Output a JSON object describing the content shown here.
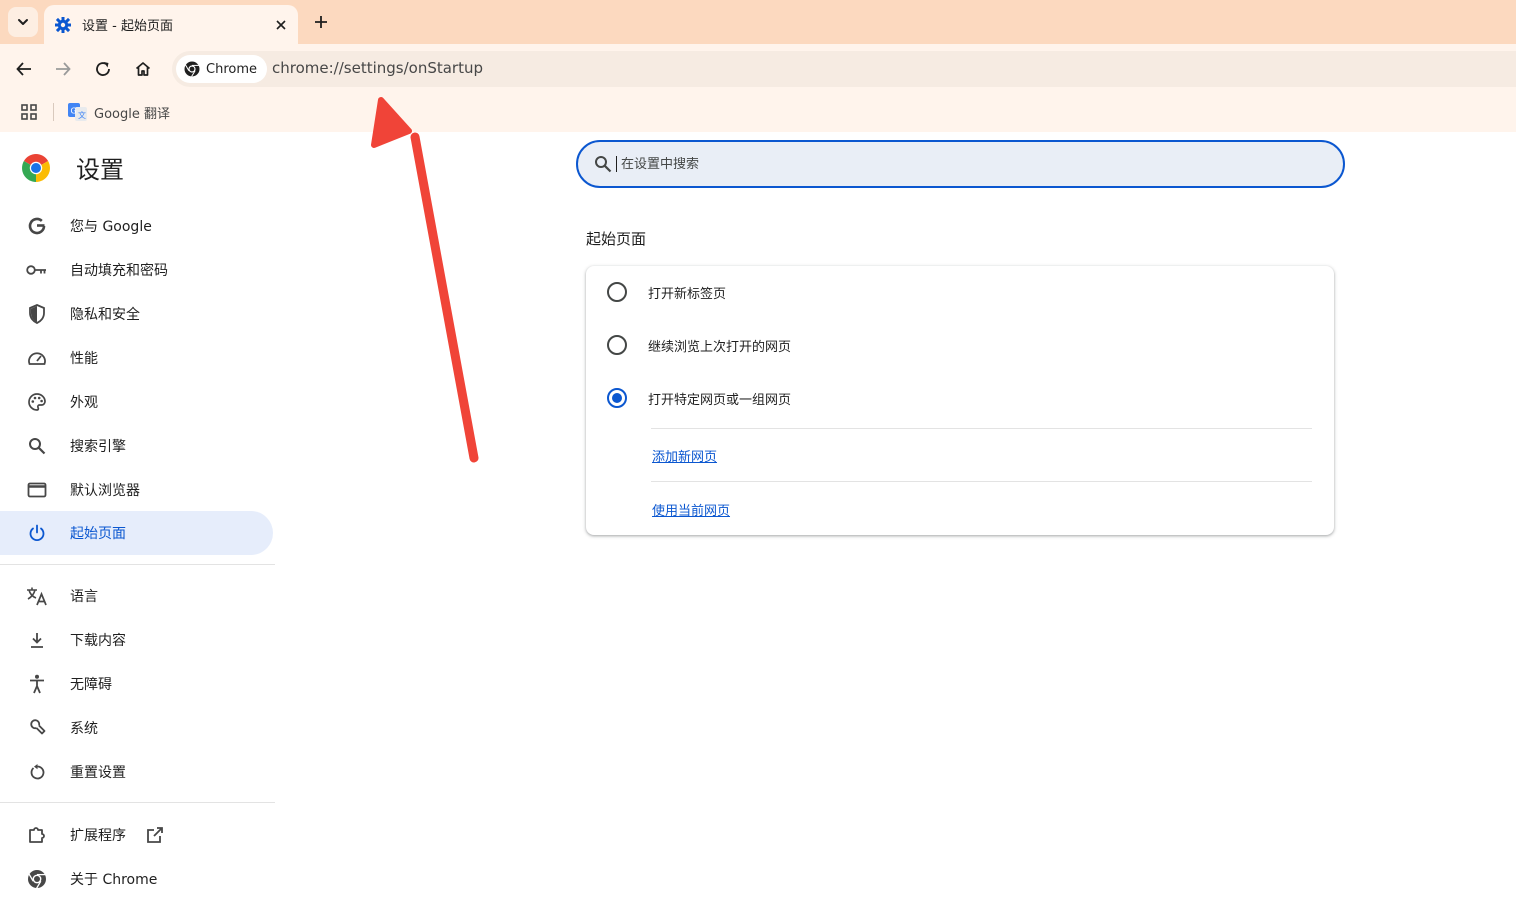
{
  "browser": {
    "tab": {
      "title": "设置 - 起始页面",
      "favicon": "gear-icon"
    },
    "toolbar": {
      "chip_label": "Chrome",
      "url": "chrome://settings/onStartup"
    },
    "bookmarks": [
      {
        "label": "Google 翻译",
        "icon": "google-translate-icon"
      }
    ]
  },
  "sidebar": {
    "title": "设置",
    "items": [
      {
        "label": "您与 Google",
        "icon": "google-g-icon",
        "active": false
      },
      {
        "label": "自动填充和密码",
        "icon": "key-icon",
        "active": false
      },
      {
        "label": "隐私和安全",
        "icon": "shield-icon",
        "active": false
      },
      {
        "label": "性能",
        "icon": "speedometer-icon",
        "active": false
      },
      {
        "label": "外观",
        "icon": "palette-icon",
        "active": false
      },
      {
        "label": "搜索引擎",
        "icon": "search-icon",
        "active": false
      },
      {
        "label": "默认浏览器",
        "icon": "browser-window-icon",
        "active": false
      },
      {
        "label": "起始页面",
        "icon": "power-icon",
        "active": true
      },
      {
        "label": "语言",
        "icon": "translate-icon",
        "active": false
      },
      {
        "label": "下载内容",
        "icon": "download-icon",
        "active": false
      },
      {
        "label": "无障碍",
        "icon": "accessibility-icon",
        "active": false
      },
      {
        "label": "系统",
        "icon": "wrench-icon",
        "active": false
      },
      {
        "label": "重置设置",
        "icon": "reset-icon",
        "active": false
      },
      {
        "label": "扩展程序",
        "icon": "puzzle-icon",
        "active": false
      },
      {
        "label": "关于 Chrome",
        "icon": "chrome-icon",
        "active": false
      }
    ]
  },
  "main": {
    "search_placeholder": "在设置中搜索",
    "section_title": "起始页面",
    "options": [
      {
        "label": "打开新标签页",
        "checked": false
      },
      {
        "label": "继续浏览上次打开的网页",
        "checked": false
      },
      {
        "label": "打开特定网页或一组网页",
        "checked": true
      }
    ],
    "links": {
      "add_page": "添加新网页",
      "use_current": "使用当前网页"
    }
  },
  "colors": {
    "accent": "#0b57d0",
    "tabstrip": "#fcd9bf",
    "toolbar": "#fff4ec",
    "active_item_bg": "#e6edfb",
    "arrow": "#f04438"
  }
}
